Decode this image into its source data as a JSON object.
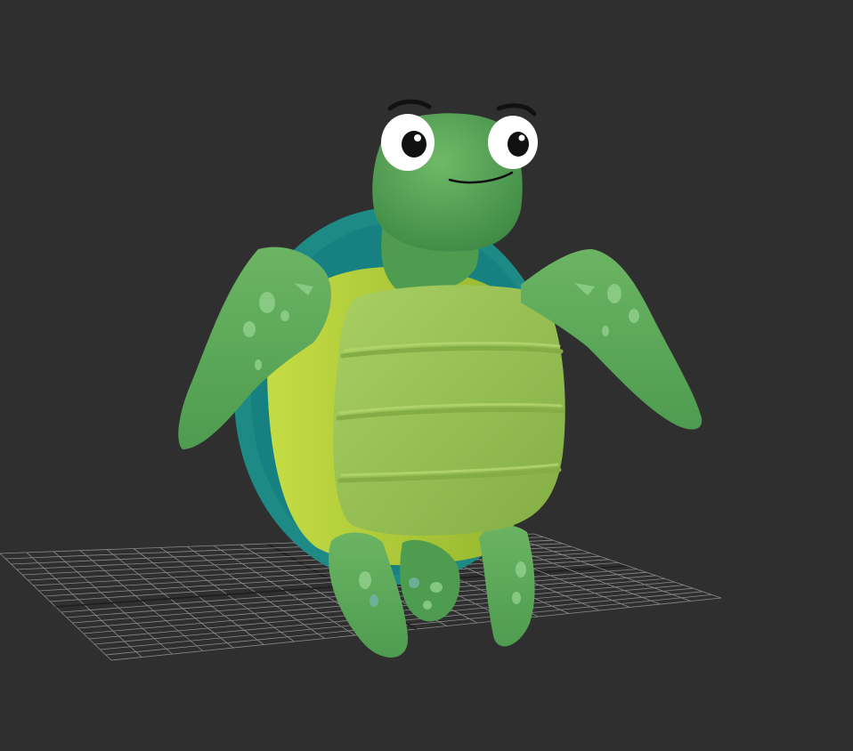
{
  "viewport": {
    "background": "#2f2f2f",
    "grid_color": "#8a8a8a",
    "grid_axis_color": "#1e1e1e"
  },
  "model": {
    "subject": "sea-turtle",
    "colors": {
      "skin": "#5fa85e",
      "skin_shadow": "#3f8a45",
      "skin_highlight": "#7cc06f",
      "plastron": "#9cc758",
      "plastron_shadow": "#86b246",
      "shell_rim": "#b5d13a",
      "shell_rim_shadow": "#8fb22c",
      "carapace": "#1e8a86",
      "carapace_dark": "#156a6a",
      "spots": "#8fcf8a",
      "spots_blue": "#6fb3a3",
      "eye_white": "#ffffff",
      "pupil": "#111111",
      "brow": "#111111"
    }
  }
}
